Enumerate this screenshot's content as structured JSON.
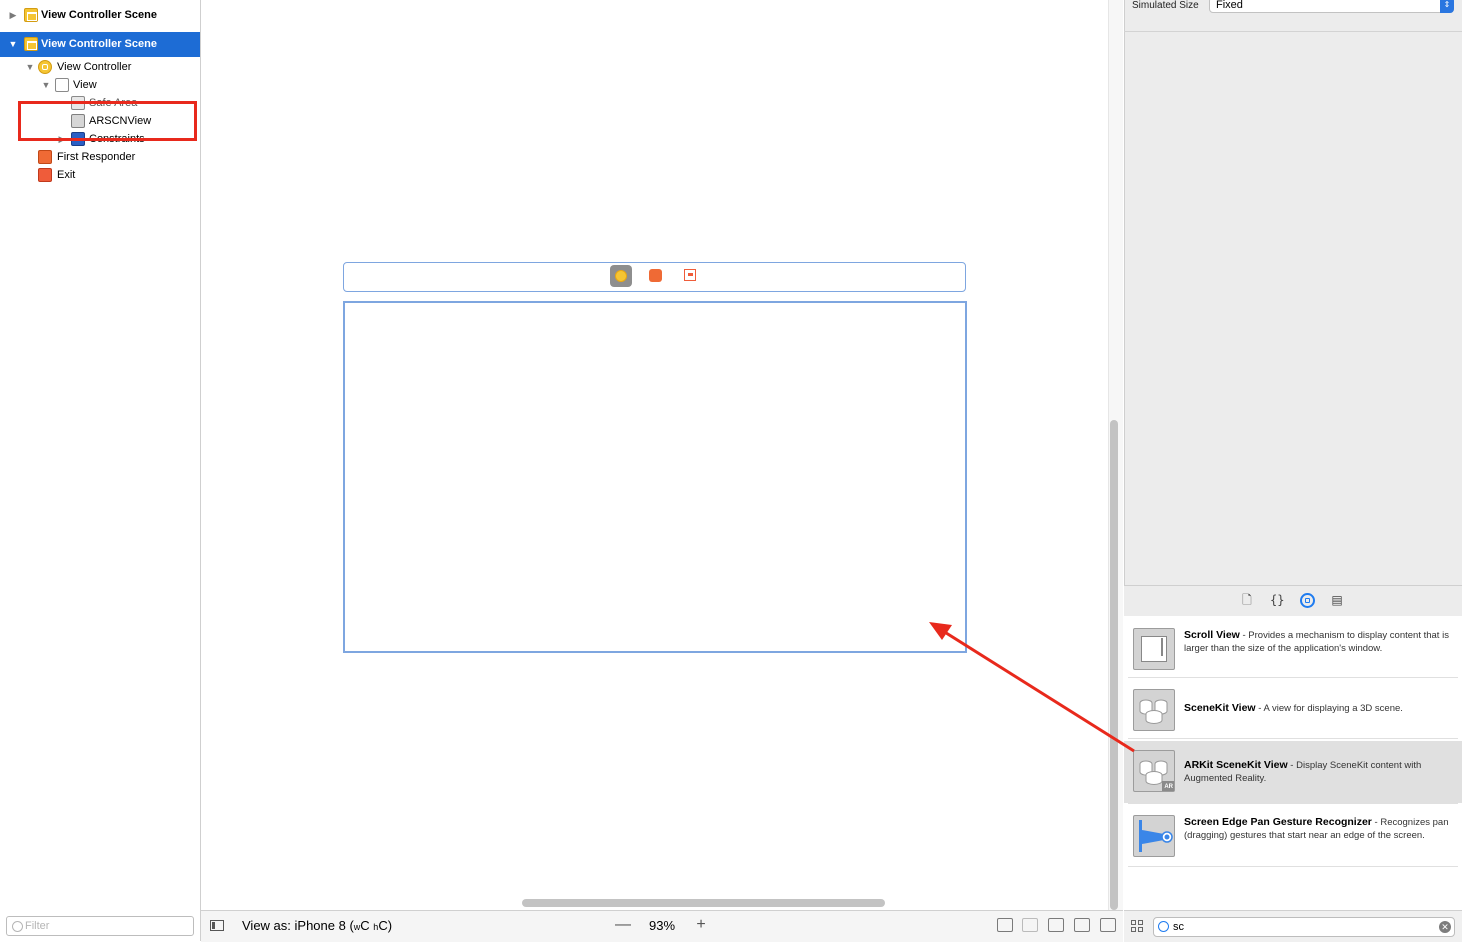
{
  "outline": {
    "rows": [
      {
        "label": "View Controller Scene"
      },
      {
        "label": "View Controller Scene"
      },
      {
        "label": "View Controller"
      },
      {
        "label": "View"
      },
      {
        "label": "Safe Area"
      },
      {
        "label": "ARSCNView"
      },
      {
        "label": "Constraints"
      },
      {
        "label": "First Responder"
      },
      {
        "label": "Exit"
      }
    ],
    "filter_placeholder": "Filter"
  },
  "canvas": {
    "view_as_prefix": "View as: iPhone 8 (",
    "w_class": "w",
    "w_value": "C",
    "h_class": "h",
    "h_value": "C",
    "view_as_suffix": ")",
    "zoom_minus": "—",
    "zoom": "93%",
    "zoom_plus": "+"
  },
  "inspector": {
    "simulated_size_label": "Simulated Size",
    "simulated_size_value": "Fixed"
  },
  "library": {
    "items": [
      {
        "title": "Scroll View",
        "desc": " - Provides a mechanism to display content that is larger than the size of the application's window."
      },
      {
        "title": "SceneKit View",
        "desc": " - A view for displaying a 3D scene."
      },
      {
        "title": "ARKit SceneKit View",
        "desc": " - Display SceneKit content with Augmented Reality."
      },
      {
        "title": "Screen Edge Pan Gesture Recognizer",
        "desc": " - Recognizes pan (dragging) gestures that start near an edge of the screen."
      }
    ],
    "ar_badge": "AR",
    "search_value": "sc"
  },
  "colors": {
    "selection": "#1d6cd5",
    "annotation_red": "#e8291c",
    "frame_blue": "#7ea6e0"
  },
  "icons": {
    "scene": "storyboard-scene-icon",
    "view_controller": "view-controller-icon",
    "first_responder": "first-responder-icon",
    "exit": "exit-icon"
  }
}
